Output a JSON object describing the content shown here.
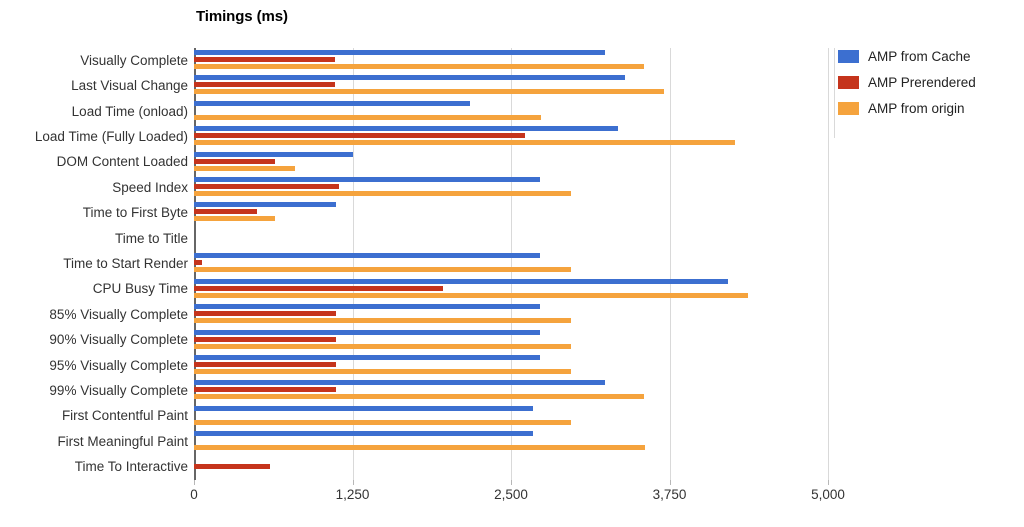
{
  "chart_data": {
    "type": "bar",
    "orientation": "horizontal",
    "title": "Timings (ms)",
    "xlabel": "",
    "ylabel": "",
    "xlim": [
      0,
      5000
    ],
    "xticks": [
      0,
      1250,
      2500,
      3750,
      5000
    ],
    "xticklabels": [
      "0",
      "1,250",
      "2,500",
      "3,750",
      "5,000"
    ],
    "grid": true,
    "grid_axis": "x",
    "legend_position": "right",
    "categories": [
      "Visually Complete",
      "Last Visual Change",
      "Load Time (onload)",
      "Load Time (Fully Loaded)",
      "DOM Content Loaded",
      "Speed Index",
      "Time to First Byte",
      "Time to Title",
      "Time to Start Render",
      "CPU Busy Time",
      "85% Visually Complete",
      "90% Visually Complete",
      "95% Visually Complete",
      "99% Visually Complete",
      "First Contentful Paint",
      "First Meaningful Paint",
      "Time To Interactive"
    ],
    "series": [
      {
        "name": "AMP from Cache",
        "color": "#3c6fd0",
        "values": [
          3240,
          3400,
          2180,
          3340,
          1250,
          2730,
          1120,
          0,
          2730,
          4210,
          2730,
          2730,
          2730,
          3240,
          2670,
          2670,
          0
        ]
      },
      {
        "name": "AMP Prerendered",
        "color": "#c5341c",
        "values": [
          1110,
          1110,
          0,
          2610,
          640,
          1140,
          500,
          0,
          60,
          1960,
          1120,
          1120,
          1120,
          1120,
          0,
          0,
          600
        ]
      },
      {
        "name": "AMP from origin",
        "color": "#f5a33d",
        "values": [
          3550,
          3710,
          2740,
          4270,
          800,
          2970,
          640,
          0,
          2970,
          4370,
          2970,
          2970,
          2970,
          3550,
          2970,
          3560,
          0
        ]
      }
    ]
  },
  "legend": {
    "items": [
      {
        "label": "AMP from Cache",
        "color": "#3c6fd0"
      },
      {
        "label": "AMP Prerendered",
        "color": "#c5341c"
      },
      {
        "label": "AMP from origin",
        "color": "#f5a33d"
      }
    ]
  }
}
